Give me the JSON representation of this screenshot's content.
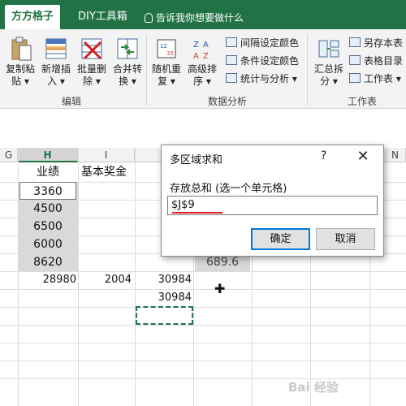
{
  "tabs": {
    "active": "方方格子",
    "diy": "DIY工具箱",
    "tell_me": "告诉我你想要做什么"
  },
  "ribbon": {
    "edit_group": {
      "label": "编辑",
      "buttons": [
        {
          "line1": "复制粘",
          "line2": "贴 ▾"
        },
        {
          "line1": "新增插",
          "line2": "入 ▾"
        },
        {
          "line1": "批量删",
          "line2": "除 ▾"
        },
        {
          "line1": "合并转",
          "line2": "换 ▾"
        }
      ]
    },
    "analysis_group": {
      "label": "数据分析",
      "buttons": [
        {
          "line1": "随机重",
          "line2": "复 ▾"
        },
        {
          "line1": "高级排",
          "line2": "序 ▾"
        }
      ],
      "small": [
        "间隔设定颜色",
        "条件设定颜色",
        "统计与分析 ▾"
      ]
    },
    "worksheet_group": {
      "label": "工作表",
      "buttons": [
        {
          "line1": "汇总拆",
          "line2": "分 ▾"
        }
      ],
      "small": [
        "另存本表",
        "表格目录",
        "工作表 ▾"
      ]
    }
  },
  "sheet": {
    "column_headers": [
      "G",
      "H",
      "I",
      "",
      "",
      "N"
    ],
    "header_row": {
      "h": "业绩",
      "i": "基本奖金"
    },
    "h_values": [
      "3360",
      "4500",
      "6500",
      "6000",
      "8620"
    ],
    "sums": {
      "h": "28980",
      "i": "2004",
      "j": "30984"
    },
    "j_second": "30984",
    "hidden_partial": "689.6",
    "cursor_glyph": "✚"
  },
  "dialog": {
    "title": "多区域求和",
    "help": "?",
    "close": "✕",
    "prompt": "存放总和 (选一个单元格)",
    "input_value": "$J$9",
    "ok_label": "确定",
    "cancel_label": "取消"
  },
  "watermark": "Bai 经验"
}
